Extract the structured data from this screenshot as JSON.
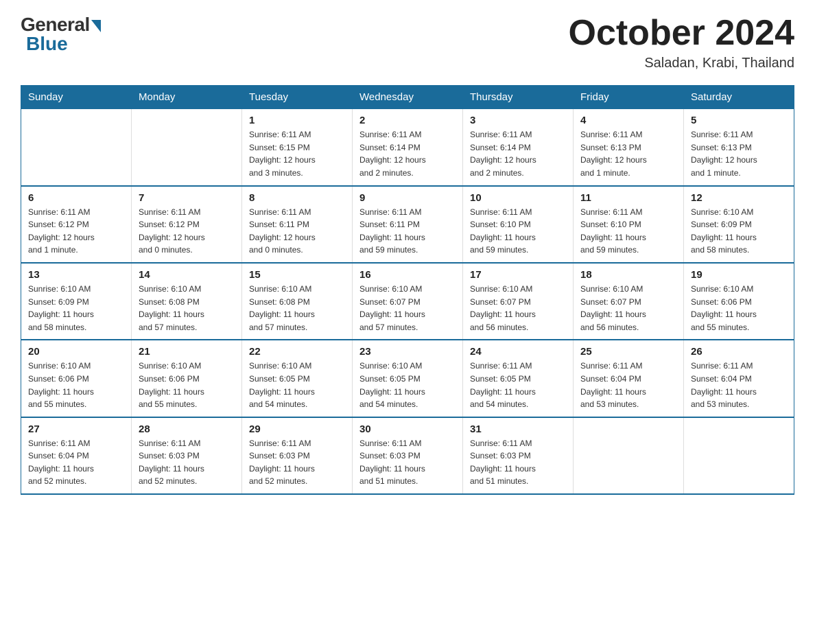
{
  "header": {
    "logo_general": "General",
    "logo_blue": "Blue",
    "month_title": "October 2024",
    "location": "Saladan, Krabi, Thailand"
  },
  "days_of_week": [
    "Sunday",
    "Monday",
    "Tuesday",
    "Wednesday",
    "Thursday",
    "Friday",
    "Saturday"
  ],
  "weeks": [
    [
      {
        "day": "",
        "info": ""
      },
      {
        "day": "",
        "info": ""
      },
      {
        "day": "1",
        "info": "Sunrise: 6:11 AM\nSunset: 6:15 PM\nDaylight: 12 hours\nand 3 minutes."
      },
      {
        "day": "2",
        "info": "Sunrise: 6:11 AM\nSunset: 6:14 PM\nDaylight: 12 hours\nand 2 minutes."
      },
      {
        "day": "3",
        "info": "Sunrise: 6:11 AM\nSunset: 6:14 PM\nDaylight: 12 hours\nand 2 minutes."
      },
      {
        "day": "4",
        "info": "Sunrise: 6:11 AM\nSunset: 6:13 PM\nDaylight: 12 hours\nand 1 minute."
      },
      {
        "day": "5",
        "info": "Sunrise: 6:11 AM\nSunset: 6:13 PM\nDaylight: 12 hours\nand 1 minute."
      }
    ],
    [
      {
        "day": "6",
        "info": "Sunrise: 6:11 AM\nSunset: 6:12 PM\nDaylight: 12 hours\nand 1 minute."
      },
      {
        "day": "7",
        "info": "Sunrise: 6:11 AM\nSunset: 6:12 PM\nDaylight: 12 hours\nand 0 minutes."
      },
      {
        "day": "8",
        "info": "Sunrise: 6:11 AM\nSunset: 6:11 PM\nDaylight: 12 hours\nand 0 minutes."
      },
      {
        "day": "9",
        "info": "Sunrise: 6:11 AM\nSunset: 6:11 PM\nDaylight: 11 hours\nand 59 minutes."
      },
      {
        "day": "10",
        "info": "Sunrise: 6:11 AM\nSunset: 6:10 PM\nDaylight: 11 hours\nand 59 minutes."
      },
      {
        "day": "11",
        "info": "Sunrise: 6:11 AM\nSunset: 6:10 PM\nDaylight: 11 hours\nand 59 minutes."
      },
      {
        "day": "12",
        "info": "Sunrise: 6:10 AM\nSunset: 6:09 PM\nDaylight: 11 hours\nand 58 minutes."
      }
    ],
    [
      {
        "day": "13",
        "info": "Sunrise: 6:10 AM\nSunset: 6:09 PM\nDaylight: 11 hours\nand 58 minutes."
      },
      {
        "day": "14",
        "info": "Sunrise: 6:10 AM\nSunset: 6:08 PM\nDaylight: 11 hours\nand 57 minutes."
      },
      {
        "day": "15",
        "info": "Sunrise: 6:10 AM\nSunset: 6:08 PM\nDaylight: 11 hours\nand 57 minutes."
      },
      {
        "day": "16",
        "info": "Sunrise: 6:10 AM\nSunset: 6:07 PM\nDaylight: 11 hours\nand 57 minutes."
      },
      {
        "day": "17",
        "info": "Sunrise: 6:10 AM\nSunset: 6:07 PM\nDaylight: 11 hours\nand 56 minutes."
      },
      {
        "day": "18",
        "info": "Sunrise: 6:10 AM\nSunset: 6:07 PM\nDaylight: 11 hours\nand 56 minutes."
      },
      {
        "day": "19",
        "info": "Sunrise: 6:10 AM\nSunset: 6:06 PM\nDaylight: 11 hours\nand 55 minutes."
      }
    ],
    [
      {
        "day": "20",
        "info": "Sunrise: 6:10 AM\nSunset: 6:06 PM\nDaylight: 11 hours\nand 55 minutes."
      },
      {
        "day": "21",
        "info": "Sunrise: 6:10 AM\nSunset: 6:06 PM\nDaylight: 11 hours\nand 55 minutes."
      },
      {
        "day": "22",
        "info": "Sunrise: 6:10 AM\nSunset: 6:05 PM\nDaylight: 11 hours\nand 54 minutes."
      },
      {
        "day": "23",
        "info": "Sunrise: 6:10 AM\nSunset: 6:05 PM\nDaylight: 11 hours\nand 54 minutes."
      },
      {
        "day": "24",
        "info": "Sunrise: 6:11 AM\nSunset: 6:05 PM\nDaylight: 11 hours\nand 54 minutes."
      },
      {
        "day": "25",
        "info": "Sunrise: 6:11 AM\nSunset: 6:04 PM\nDaylight: 11 hours\nand 53 minutes."
      },
      {
        "day": "26",
        "info": "Sunrise: 6:11 AM\nSunset: 6:04 PM\nDaylight: 11 hours\nand 53 minutes."
      }
    ],
    [
      {
        "day": "27",
        "info": "Sunrise: 6:11 AM\nSunset: 6:04 PM\nDaylight: 11 hours\nand 52 minutes."
      },
      {
        "day": "28",
        "info": "Sunrise: 6:11 AM\nSunset: 6:03 PM\nDaylight: 11 hours\nand 52 minutes."
      },
      {
        "day": "29",
        "info": "Sunrise: 6:11 AM\nSunset: 6:03 PM\nDaylight: 11 hours\nand 52 minutes."
      },
      {
        "day": "30",
        "info": "Sunrise: 6:11 AM\nSunset: 6:03 PM\nDaylight: 11 hours\nand 51 minutes."
      },
      {
        "day": "31",
        "info": "Sunrise: 6:11 AM\nSunset: 6:03 PM\nDaylight: 11 hours\nand 51 minutes."
      },
      {
        "day": "",
        "info": ""
      },
      {
        "day": "",
        "info": ""
      }
    ]
  ]
}
